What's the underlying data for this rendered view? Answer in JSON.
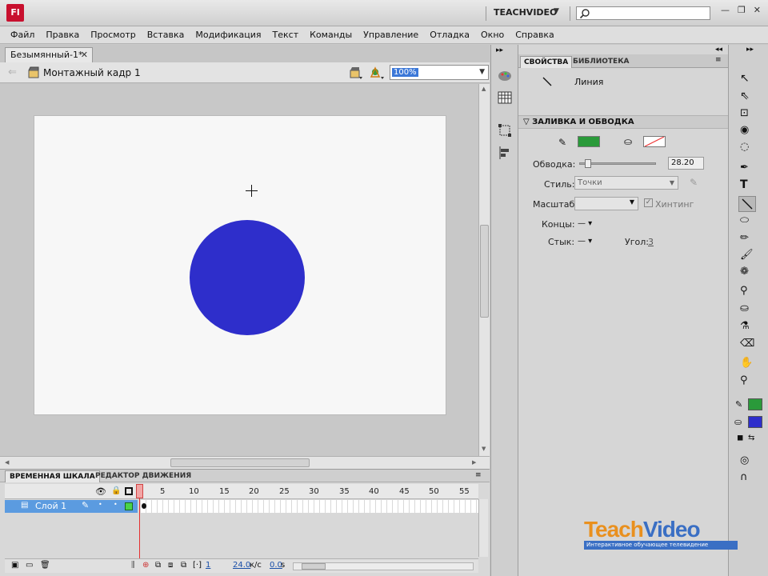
{
  "app": {
    "logo": "Fl",
    "workspace": "TEACHVIDEO"
  },
  "menu": [
    "Файл",
    "Правка",
    "Просмотр",
    "Вставка",
    "Модификация",
    "Текст",
    "Команды",
    "Управление",
    "Отладка",
    "Окно",
    "Справка"
  ],
  "document": {
    "tab": "Безымянный-1*",
    "scene": "Монтажный кадр 1",
    "zoom": "100%"
  },
  "colors": {
    "circle": "#2e2ecb",
    "stroke": "#2a9a3a",
    "fill": "#2e2ecb",
    "accent": "#5b9be0"
  },
  "timeline": {
    "tabs": [
      "ВРЕМЕННАЯ ШКАЛА",
      "РЕДАКТОР ДВИЖЕНИЯ"
    ],
    "layer": "Слой 1",
    "frame_numbers": [
      "1",
      "5",
      "10",
      "15",
      "20",
      "25",
      "30",
      "35",
      "40",
      "45",
      "50",
      "55"
    ],
    "current_frame": "1",
    "fps": "24.0",
    "fps_unit": "к/с",
    "time": "0.0",
    "time_unit": "s"
  },
  "properties": {
    "tabs": [
      "СВОЙСТВА",
      "БИБЛИОТЕКА"
    ],
    "tool_name": "Линия",
    "section": "ЗАЛИВКА И ОБВОДКА",
    "stroke_label": "Обводка:",
    "stroke_value": "28.20",
    "style_label": "Стиль:",
    "style_value": "Точки",
    "scale_label": "Масштаб:",
    "hinting_label": "Хинтинг",
    "caps_label": "Концы:",
    "joins_label": "Стык:",
    "angle_label": "Угол:",
    "angle_value": "3"
  },
  "watermark": {
    "brand_teach": "Teach",
    "brand_video": "Video",
    "tagline": "Интерактивное обучающее телевидение"
  }
}
